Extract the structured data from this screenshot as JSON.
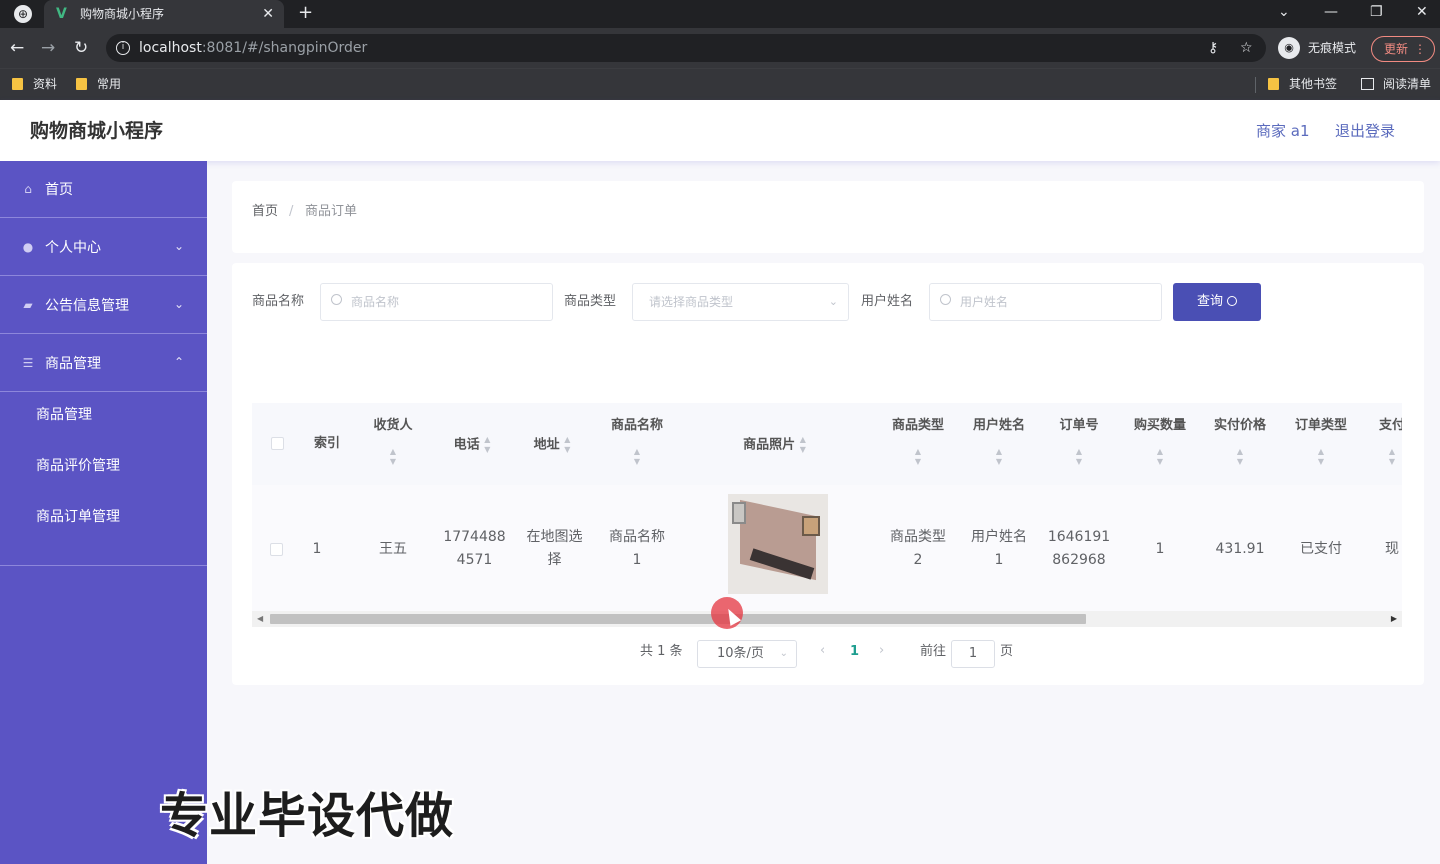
{
  "browser": {
    "tab_title": "购物商城小程序",
    "tab_favicon": "V",
    "url_host": "localhost",
    "url_rest": ":8081/#/shangpinOrder",
    "incognito_label": "无痕模式",
    "update_label": "更新",
    "bookmarks": [
      "资料",
      "常用"
    ],
    "other_bookmarks": "其他书签",
    "reading_list": "阅读清单"
  },
  "header": {
    "title": "购物商城小程序",
    "user": "商家 a1",
    "logout": "退出登录"
  },
  "sidebar": {
    "items": [
      {
        "label": "首页",
        "icon": "home-icon"
      },
      {
        "label": "个人中心",
        "icon": "user-icon"
      },
      {
        "label": "公告信息管理",
        "icon": "notice-icon"
      },
      {
        "label": "商品管理",
        "icon": "list-icon"
      }
    ],
    "submenu": [
      "商品管理",
      "商品评价管理",
      "商品订单管理"
    ]
  },
  "breadcrumb": {
    "home": "首页",
    "separator": "/",
    "current": "商品订单"
  },
  "filters": {
    "name_label": "商品名称",
    "name_placeholder": "商品名称",
    "type_label": "商品类型",
    "type_placeholder": "请选择商品类型",
    "user_label": "用户姓名",
    "user_placeholder": "用户姓名",
    "query_label": "查询"
  },
  "table": {
    "columns": [
      "索引",
      "收货人",
      "电话",
      "地址",
      "商品名称",
      "商品照片",
      "商品类型",
      "用户姓名",
      "订单号",
      "购买数量",
      "实付价格",
      "订单类型",
      "支付"
    ],
    "rows": [
      {
        "index": "1",
        "receiver": "王五",
        "phone": [
          "1774488",
          "4571"
        ],
        "address": [
          "在地图选",
          "择"
        ],
        "product_name": [
          "商品名称",
          "1"
        ],
        "product_type": [
          "商品类型",
          "2"
        ],
        "user_name": [
          "用户姓名",
          "1"
        ],
        "order_no": [
          "1646191",
          "862968"
        ],
        "quantity": "1",
        "price": "431.91",
        "order_type": "已支付",
        "pay": "现"
      }
    ]
  },
  "pagination": {
    "total": "共 1 条",
    "page_size": "10条/页",
    "current_page": "1",
    "goto_label": "前往",
    "goto_value": "1",
    "goto_unit": "页"
  },
  "watermark": "专业毕设代做"
}
